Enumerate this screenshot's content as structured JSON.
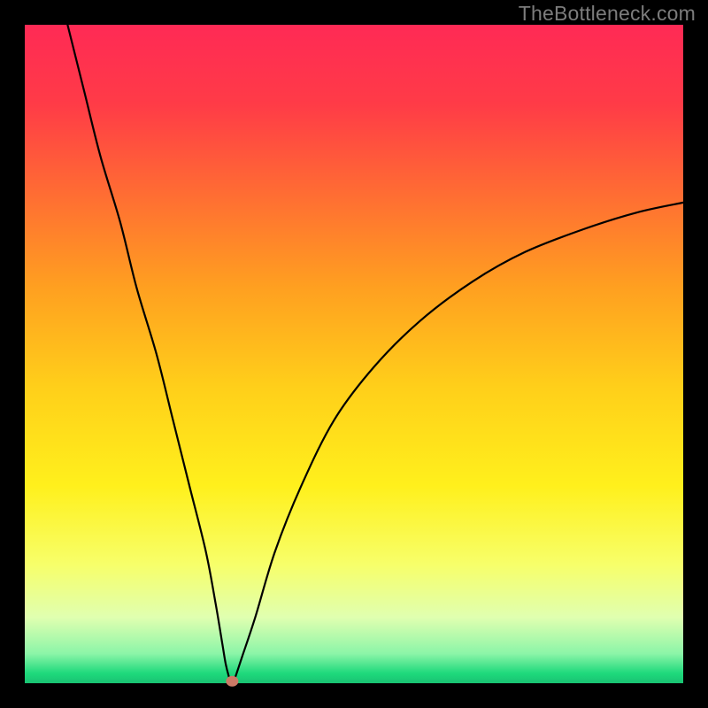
{
  "watermark": "TheBottleneck.com",
  "chart_data": {
    "type": "line",
    "title": "",
    "xlabel": "",
    "ylabel": "",
    "xlim": [
      0,
      100
    ],
    "ylim": [
      0,
      100
    ],
    "gradient_stops": [
      {
        "offset": 0.0,
        "color": "#ff2a55"
      },
      {
        "offset": 0.12,
        "color": "#ff3b47"
      },
      {
        "offset": 0.25,
        "color": "#ff6a34"
      },
      {
        "offset": 0.4,
        "color": "#ffa020"
      },
      {
        "offset": 0.55,
        "color": "#ffcf1a"
      },
      {
        "offset": 0.7,
        "color": "#fff01c"
      },
      {
        "offset": 0.82,
        "color": "#f7ff6a"
      },
      {
        "offset": 0.9,
        "color": "#e0ffb0"
      },
      {
        "offset": 0.955,
        "color": "#8cf5a8"
      },
      {
        "offset": 0.985,
        "color": "#1ed97c"
      },
      {
        "offset": 1.0,
        "color": "#19c272"
      }
    ],
    "curve_points": [
      {
        "x": 6.5,
        "y": 100.0
      },
      {
        "x": 9.0,
        "y": 90.0
      },
      {
        "x": 11.5,
        "y": 80.0
      },
      {
        "x": 14.5,
        "y": 70.0
      },
      {
        "x": 17.0,
        "y": 60.0
      },
      {
        "x": 20.0,
        "y": 50.0
      },
      {
        "x": 22.5,
        "y": 40.0
      },
      {
        "x": 25.0,
        "y": 30.0
      },
      {
        "x": 27.5,
        "y": 20.0
      },
      {
        "x": 29.0,
        "y": 12.0
      },
      {
        "x": 30.0,
        "y": 6.0
      },
      {
        "x": 30.5,
        "y": 3.0
      },
      {
        "x": 31.0,
        "y": 1.0
      },
      {
        "x": 31.3,
        "y": 0.3
      },
      {
        "x": 31.7,
        "y": 0.3
      },
      {
        "x": 32.0,
        "y": 1.0
      },
      {
        "x": 33.0,
        "y": 4.0
      },
      {
        "x": 35.0,
        "y": 10.0
      },
      {
        "x": 38.0,
        "y": 20.0
      },
      {
        "x": 42.0,
        "y": 30.0
      },
      {
        "x": 47.0,
        "y": 40.0
      },
      {
        "x": 53.0,
        "y": 48.0
      },
      {
        "x": 60.0,
        "y": 55.0
      },
      {
        "x": 68.0,
        "y": 61.0
      },
      {
        "x": 76.0,
        "y": 65.5
      },
      {
        "x": 85.0,
        "y": 69.0
      },
      {
        "x": 93.0,
        "y": 71.5
      },
      {
        "x": 100.0,
        "y": 73.0
      }
    ],
    "minimum_marker": {
      "x": 31.5,
      "y": 0.3
    },
    "background": "#000000"
  }
}
